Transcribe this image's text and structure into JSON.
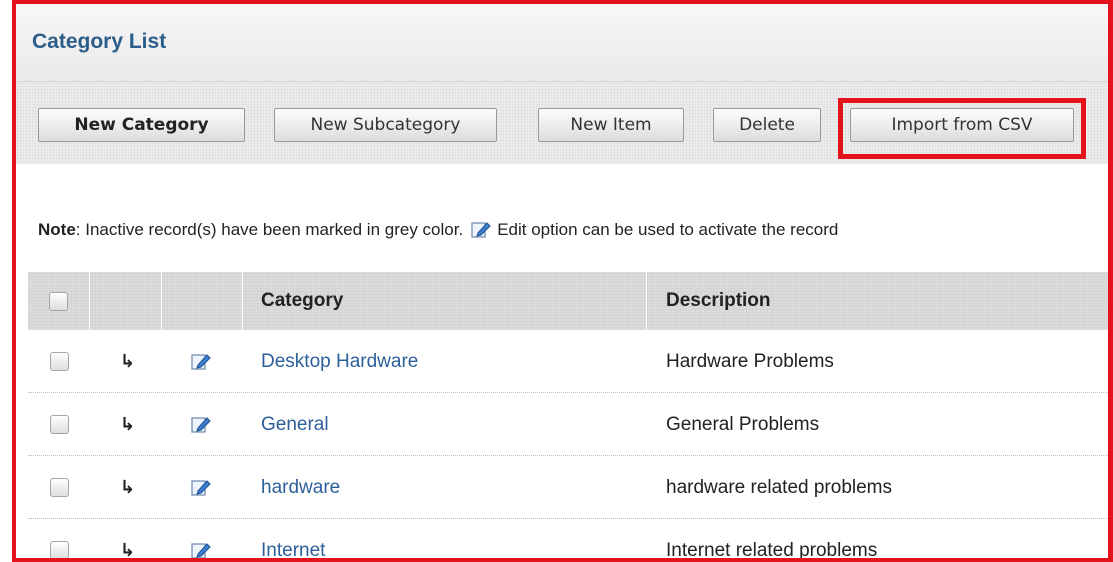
{
  "panel": {
    "title": "Category List"
  },
  "toolbar": {
    "new_category": "New Category",
    "new_subcategory": "New Subcategory",
    "new_item": "New Item",
    "delete": "Delete",
    "import_csv": "Import from CSV"
  },
  "note": {
    "label": "Note",
    "text_before": " : Inactive record(s) have been marked in grey color.",
    "text_after": "Edit option can be used to activate the record"
  },
  "table": {
    "headers": [
      "Category",
      "Description"
    ],
    "rows": [
      {
        "category": "Desktop Hardware",
        "description": "Hardware Problems"
      },
      {
        "category": "General",
        "description": "General Problems"
      },
      {
        "category": "hardware",
        "description": "hardware related problems"
      },
      {
        "category": "Internet",
        "description": "Internet related problems"
      }
    ]
  },
  "colors": {
    "highlight": "#e3131b",
    "link": "#2d5f9a",
    "title": "#2b5d8a"
  },
  "icons": {
    "subcategory": "subcategory-arrow-icon",
    "edit": "edit-pencil-icon"
  }
}
